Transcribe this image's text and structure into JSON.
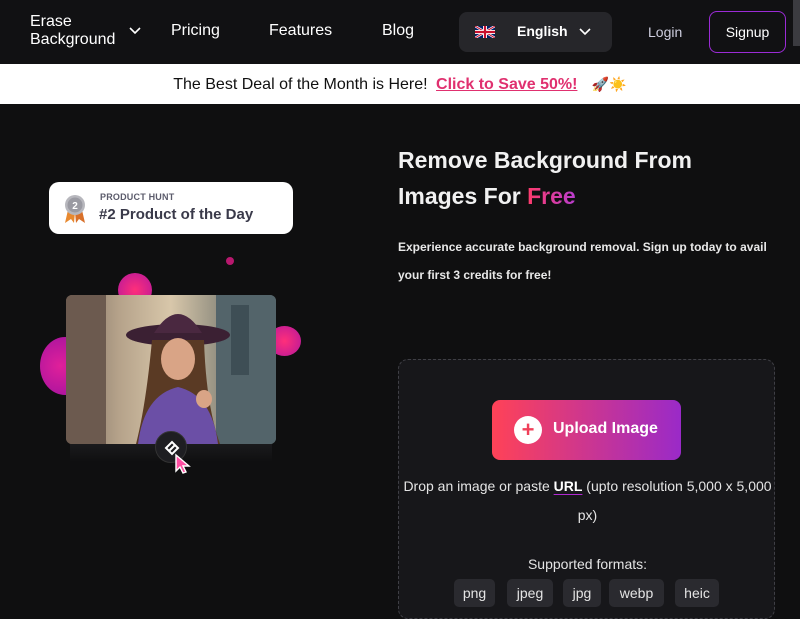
{
  "nav": {
    "logo_line1": "Erase",
    "logo_line2": "Background",
    "links": [
      "Pricing",
      "Features",
      "Blog"
    ],
    "language": "English",
    "login": "Login",
    "signup": "Signup"
  },
  "banner": {
    "text": "The Best Deal of the Month is Here!",
    "cta": "Click to Save 50%!",
    "emoji": "🚀☀️"
  },
  "product_hunt": {
    "small": "PRODUCT HUNT",
    "big": "#2 Product of the Day",
    "medal_number": "2"
  },
  "hero": {
    "title_line1": "Remove Background From",
    "title_line2_prefix": "Images For ",
    "title_highlight": "Free",
    "subtitle": "Experience accurate background removal. Sign up today to avail your first 3 credits for free!"
  },
  "upload": {
    "button_label": "Upload Image",
    "drop_prefix": "Drop an image or paste ",
    "drop_link": "URL",
    "drop_suffix": " (upto resolution 5,000 x 5,000 px)",
    "formats_label": "Supported formats:",
    "formats": [
      "png",
      "jpeg",
      "jpg",
      "webp",
      "heic"
    ]
  },
  "colors": {
    "accent_pink": "#ff3b6b",
    "accent_purple": "#9b2bd6",
    "background": "#0f0f10"
  }
}
